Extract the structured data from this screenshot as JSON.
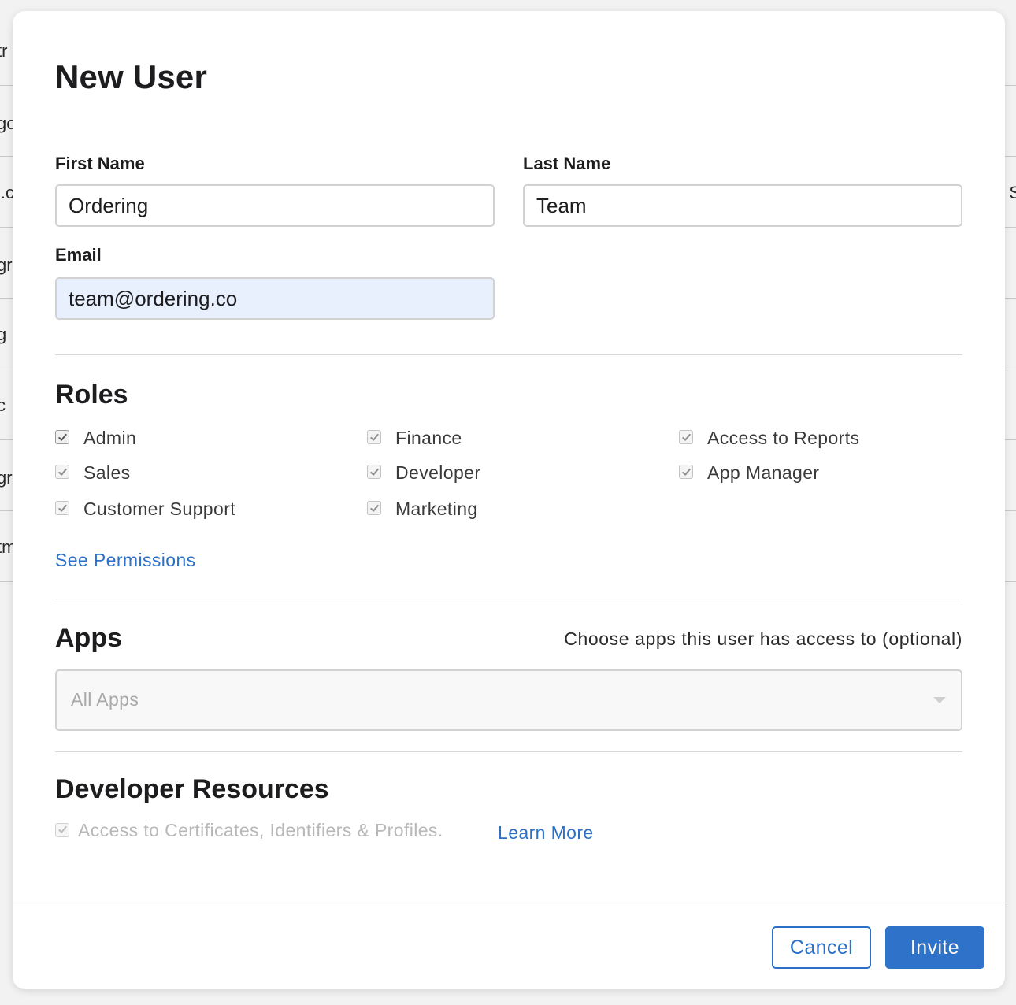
{
  "background_fragments": {
    "left": [
      "tr",
      "go",
      "l.c",
      "gr",
      "g",
      "c",
      "gr",
      "tm"
    ],
    "right": [
      "S"
    ]
  },
  "modal": {
    "title": "New User",
    "first_name": {
      "label": "First Name",
      "value": "Ordering"
    },
    "last_name": {
      "label": "Last Name",
      "value": "Team"
    },
    "email": {
      "label": "Email",
      "value": "team@ordering.co"
    },
    "roles": {
      "title": "Roles",
      "items": [
        {
          "label": "Admin",
          "checked": true
        },
        {
          "label": "Finance",
          "checked": true
        },
        {
          "label": "Access to Reports",
          "checked": true
        },
        {
          "label": "Sales",
          "checked": true
        },
        {
          "label": "Developer",
          "checked": true
        },
        {
          "label": "App Manager",
          "checked": true
        },
        {
          "label": "Customer Support",
          "checked": true
        },
        {
          "label": "Marketing",
          "checked": true
        }
      ],
      "see_permissions": "See Permissions"
    },
    "apps": {
      "title": "Apps",
      "hint": "Choose apps this user has access to (optional)",
      "selected": "All Apps"
    },
    "developer_resources": {
      "title": "Developer Resources",
      "item": {
        "label": "Access to Certificates, Identifiers & Profiles.",
        "checked": true,
        "disabled": true
      },
      "learn_more": "Learn More"
    },
    "buttons": {
      "cancel": "Cancel",
      "invite": "Invite"
    }
  },
  "colors": {
    "accent": "#2b6fc7",
    "primary_button": "#2f72c9",
    "autofill": "#e8f0fe",
    "text": "#1d1d1f"
  }
}
